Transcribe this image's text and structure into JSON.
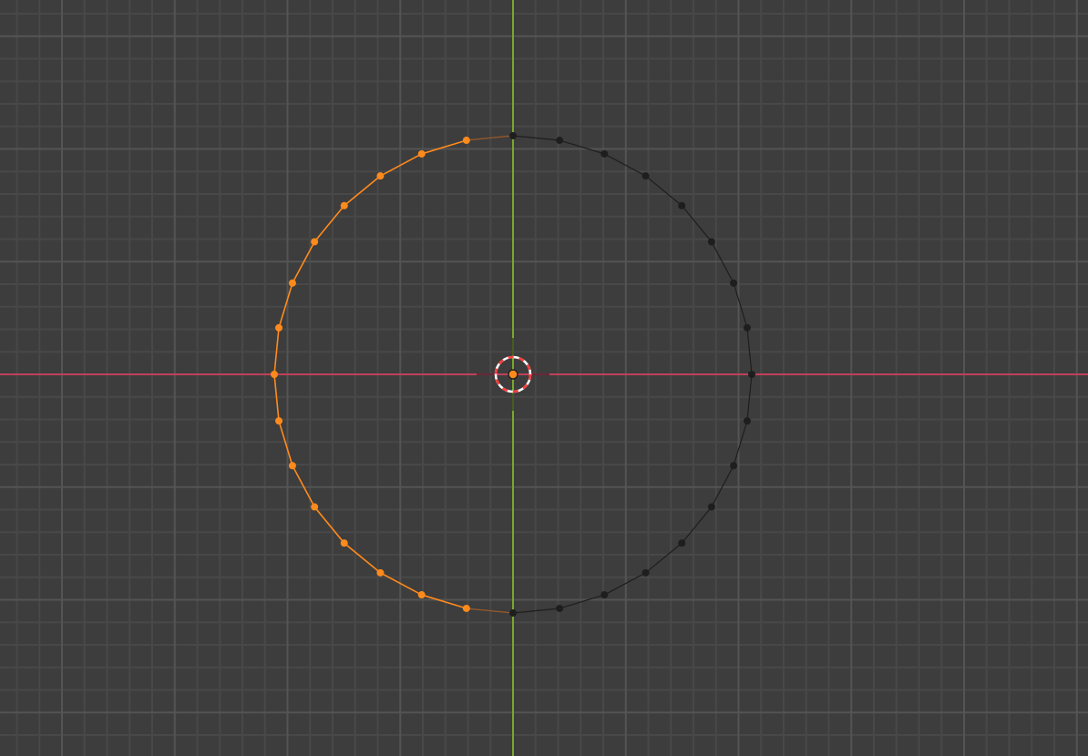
{
  "viewport": {
    "background_color": "#3d3d3d",
    "grid_minor_color": "#484848",
    "grid_major_color": "#545454",
    "x_axis_color": "#c0405a",
    "y_axis_color": "#7aa82a"
  },
  "mesh": {
    "type": "circle",
    "vertex_count": 32,
    "selected_color": "#ff8a1c",
    "unselected_color": "#1e1e1e",
    "selected_side": "left",
    "unselected_side": "right"
  },
  "cursor_3d": {
    "icon": "3d-cursor-icon",
    "ring_colors": [
      "#ff3b3b",
      "#ffffff"
    ]
  },
  "origin": {
    "icon": "object-origin-icon",
    "color": "#ff8a1c"
  }
}
